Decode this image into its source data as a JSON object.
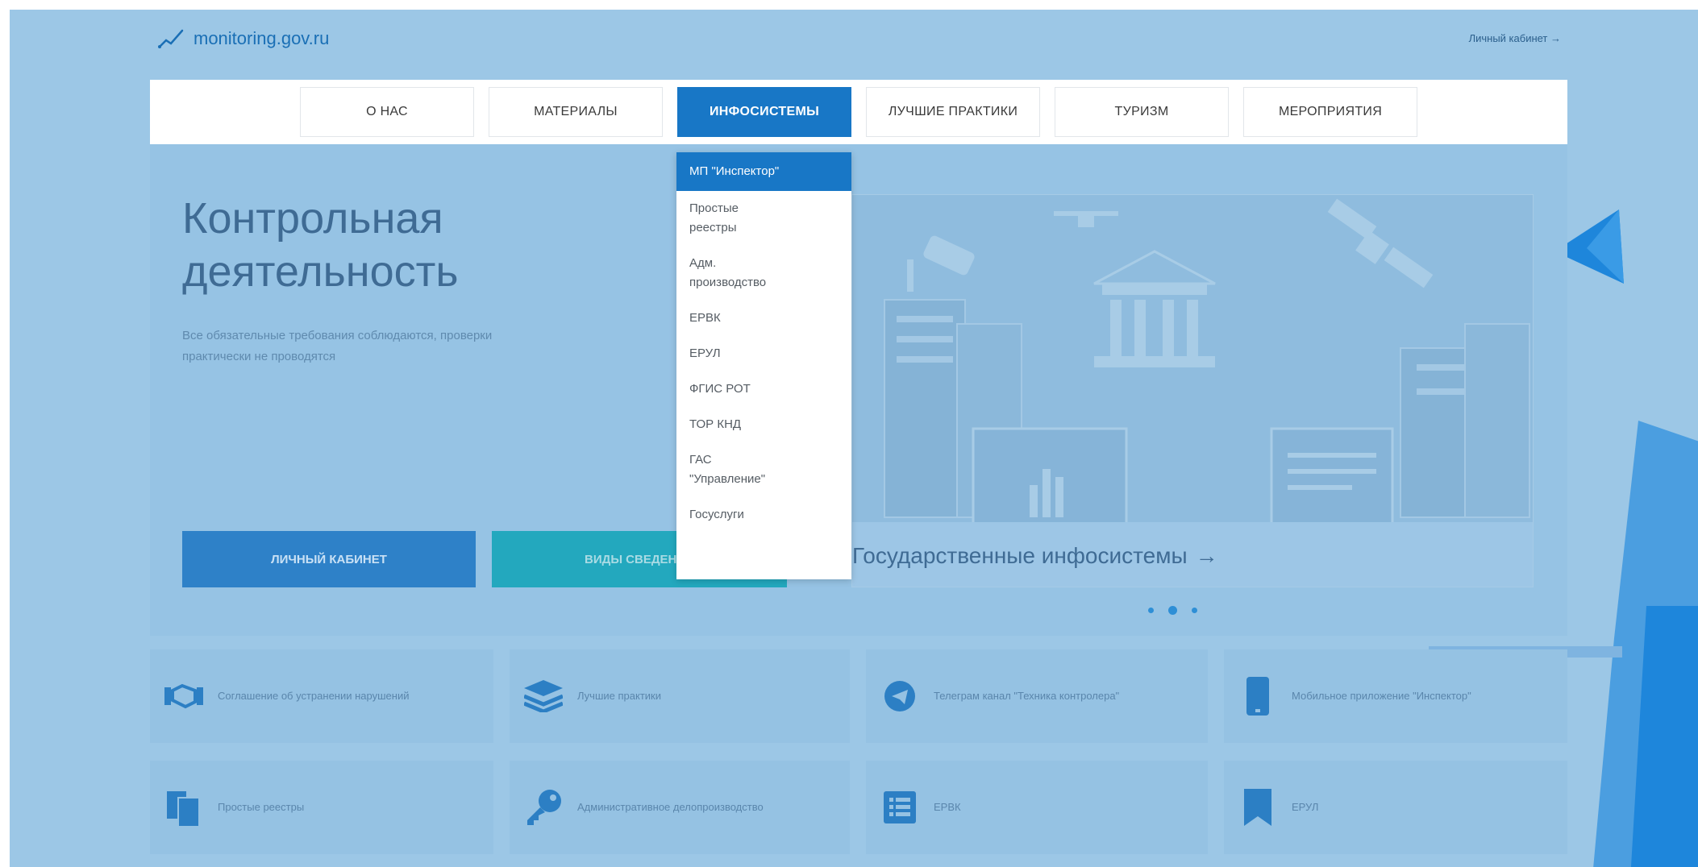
{
  "header": {
    "logo_text": "monitoring.gov.ru",
    "account_link": "Личный кабинет →"
  },
  "nav": {
    "items": [
      {
        "label": "О НАС",
        "active": false
      },
      {
        "label": "МАТЕРИАЛЫ",
        "active": false
      },
      {
        "label": "ИНФОСИСТЕМЫ",
        "active": true
      },
      {
        "label": "ЛУЧШИЕ ПРАКТИКИ",
        "active": false
      },
      {
        "label": "ТУРИЗМ",
        "active": false
      },
      {
        "label": "МЕРОПРИЯТИЯ",
        "active": false
      }
    ]
  },
  "dropdown": {
    "items": [
      {
        "label": "МП \"Инспектор\"",
        "active": true
      },
      {
        "label": "Простые\nреестры",
        "active": false
      },
      {
        "label": "Адм.\nпроизводство",
        "active": false
      },
      {
        "label": "ЕРВК",
        "active": false
      },
      {
        "label": "ЕРУЛ",
        "active": false
      },
      {
        "label": "ФГИС РОТ",
        "active": false
      },
      {
        "label": "ТОР КНД",
        "active": false
      },
      {
        "label": "ГАС\n\"Управление\"",
        "active": false
      },
      {
        "label": "Госуслуги",
        "active": false
      }
    ]
  },
  "hero": {
    "title_line1": "Контрольная",
    "title_line2": "деятельность",
    "subtitle": "Все обязательные требования соблюдаются, проверки практически не проводятся",
    "btn_cabinet": "ЛИЧНЫЙ КАБИНЕТ",
    "btn_kinds": "ВИДЫ СВЕДЕНИЙ",
    "slide_caption": "Государственные инфосистемы",
    "slide_arrow": "→",
    "slides_total": 3,
    "slide_active": 2
  },
  "tiles": [
    {
      "label": "Соглашение об устранении нарушений",
      "icon": "handshake-icon"
    },
    {
      "label": "Лучшие практики",
      "icon": "layers-icon"
    },
    {
      "label": "Телеграм канал \"Техника контролера\"",
      "icon": "telegram-icon"
    },
    {
      "label": "Мобильное приложение \"Инспектор\"",
      "icon": "mobile-phone-icon"
    },
    {
      "label": "Простые реестры",
      "icon": "documents-icon"
    },
    {
      "label": "Административное делопроизводство",
      "icon": "key-icon"
    },
    {
      "label": "ЕРВК",
      "icon": "list-icon"
    },
    {
      "label": "ЕРУЛ",
      "icon": "bookmark-icon"
    }
  ],
  "colors": {
    "accent": "#1877c6",
    "teal": "#23a8be",
    "background": "#9cc7e6"
  }
}
